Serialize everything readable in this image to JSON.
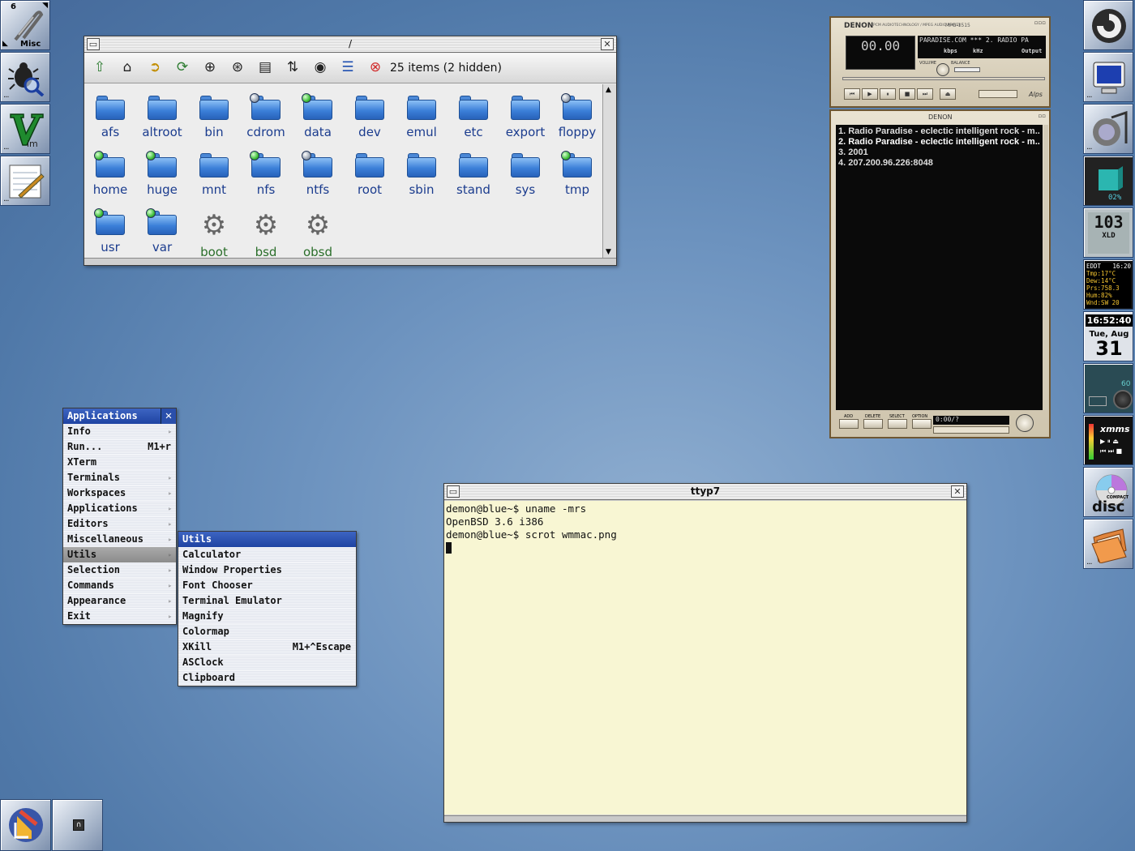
{
  "left_dock": {
    "misc_label": "Misc",
    "workspace_number": "6"
  },
  "file_manager": {
    "title": "/",
    "item_count": "25 items (2 hidden)",
    "items": [
      {
        "name": "afs",
        "kind": "folder"
      },
      {
        "name": "altroot",
        "kind": "folder"
      },
      {
        "name": "bin",
        "kind": "folder"
      },
      {
        "name": "cdrom",
        "kind": "folder",
        "mount": "grey"
      },
      {
        "name": "data",
        "kind": "folder",
        "mount": "green"
      },
      {
        "name": "dev",
        "kind": "folder"
      },
      {
        "name": "emul",
        "kind": "folder"
      },
      {
        "name": "etc",
        "kind": "folder"
      },
      {
        "name": "export",
        "kind": "folder"
      },
      {
        "name": "floppy",
        "kind": "folder",
        "mount": "grey"
      },
      {
        "name": "home",
        "kind": "folder",
        "mount": "green"
      },
      {
        "name": "huge",
        "kind": "folder",
        "mount": "green"
      },
      {
        "name": "mnt",
        "kind": "folder"
      },
      {
        "name": "nfs",
        "kind": "folder",
        "mount": "green"
      },
      {
        "name": "ntfs",
        "kind": "folder",
        "mount": "grey"
      },
      {
        "name": "root",
        "kind": "folder"
      },
      {
        "name": "sbin",
        "kind": "folder"
      },
      {
        "name": "stand",
        "kind": "folder"
      },
      {
        "name": "sys",
        "kind": "folder"
      },
      {
        "name": "tmp",
        "kind": "folder",
        "mount": "green"
      },
      {
        "name": "usr",
        "kind": "folder",
        "mount": "green"
      },
      {
        "name": "var",
        "kind": "folder",
        "mount": "green"
      },
      {
        "name": "boot",
        "kind": "gear"
      },
      {
        "name": "bsd",
        "kind": "gear"
      },
      {
        "name": "obsd",
        "kind": "gear"
      }
    ]
  },
  "apps_menu": {
    "title": "Applications",
    "items": [
      {
        "label": "Info",
        "shortcut": "",
        "submenu": true
      },
      {
        "label": "Run...",
        "shortcut": "M1+r",
        "submenu": false
      },
      {
        "label": "XTerm",
        "shortcut": "",
        "submenu": false
      },
      {
        "label": "Terminals",
        "shortcut": "",
        "submenu": true
      },
      {
        "label": "Workspaces",
        "shortcut": "",
        "submenu": true
      },
      {
        "label": "Applications",
        "shortcut": "",
        "submenu": true
      },
      {
        "label": "Editors",
        "shortcut": "",
        "submenu": true
      },
      {
        "label": "Miscellaneous",
        "shortcut": "",
        "submenu": true
      },
      {
        "label": "Utils",
        "shortcut": "",
        "submenu": true,
        "selected": true
      },
      {
        "label": "Selection",
        "shortcut": "",
        "submenu": true
      },
      {
        "label": "Commands",
        "shortcut": "",
        "submenu": true
      },
      {
        "label": "Appearance",
        "shortcut": "",
        "submenu": true
      },
      {
        "label": "Exit",
        "shortcut": "",
        "submenu": true
      }
    ]
  },
  "utils_menu": {
    "title": "Utils",
    "items": [
      {
        "label": "Calculator",
        "shortcut": ""
      },
      {
        "label": "Window Properties",
        "shortcut": ""
      },
      {
        "label": "Font Chooser",
        "shortcut": ""
      },
      {
        "label": "Terminal Emulator",
        "shortcut": ""
      },
      {
        "label": "Magnify",
        "shortcut": ""
      },
      {
        "label": "Colormap",
        "shortcut": ""
      },
      {
        "label": "XKill",
        "shortcut": "M1+^Escape"
      },
      {
        "label": "ASClock",
        "shortcut": ""
      },
      {
        "label": "Clipboard",
        "shortcut": ""
      }
    ]
  },
  "terminal": {
    "title": "ttyp7",
    "lines": [
      "demon@blue~$ uname -mrs",
      "OpenBSD 3.6 i386",
      "demon@blue~$ scrot wmmac.png"
    ]
  },
  "xmms": {
    "brand": "DENON",
    "model": "MPG-1515",
    "tagline": "PCM AUDIOTECHNOLOGY / MPEG AUDIO PLAYER",
    "time": "00.00",
    "song_ticker": "PARADISE.COM  *** 2. RADIO PA",
    "kbps_label": "kbps",
    "khz_label": "kHz",
    "output_label": "Output",
    "volume_label": "VOLUME",
    "balance_label": "BALANCE",
    "playlist_brand": "DENON",
    "playlist": [
      "1. Radio Paradise - eclectic intelligent rock - m...",
      "2.  Radio Paradise - eclectic intelligent rock - m...",
      "3. 2001",
      "4. 207.200.96.226:8048"
    ],
    "pl_buttons": [
      "ADD",
      "DELETE",
      "SELECT",
      "OPTION"
    ],
    "pl_time": "0:00/?"
  },
  "right_dock": {
    "cpu_percent": "02%",
    "load_value": "103",
    "load_label": "XLD",
    "weather": {
      "station": "EDDT",
      "time": "16:20",
      "tmp": "Tmp:17°C",
      "dew": "Dew:14°C",
      "prs": "Prs:758.3",
      "hum": "Hum:82%",
      "wnd": "Wnd:SW 20"
    },
    "clock": "16:52:40",
    "date_day": "Tue, Aug",
    "date_num": "31",
    "xmms_label": "xmms",
    "disc_label": "disc",
    "compact_label": "COMPACT",
    "mixer_value": "60"
  },
  "colors": {
    "accent": "#2a4fab",
    "desktop": "#5c84b4",
    "terminal_bg": "#f8f6d3"
  }
}
